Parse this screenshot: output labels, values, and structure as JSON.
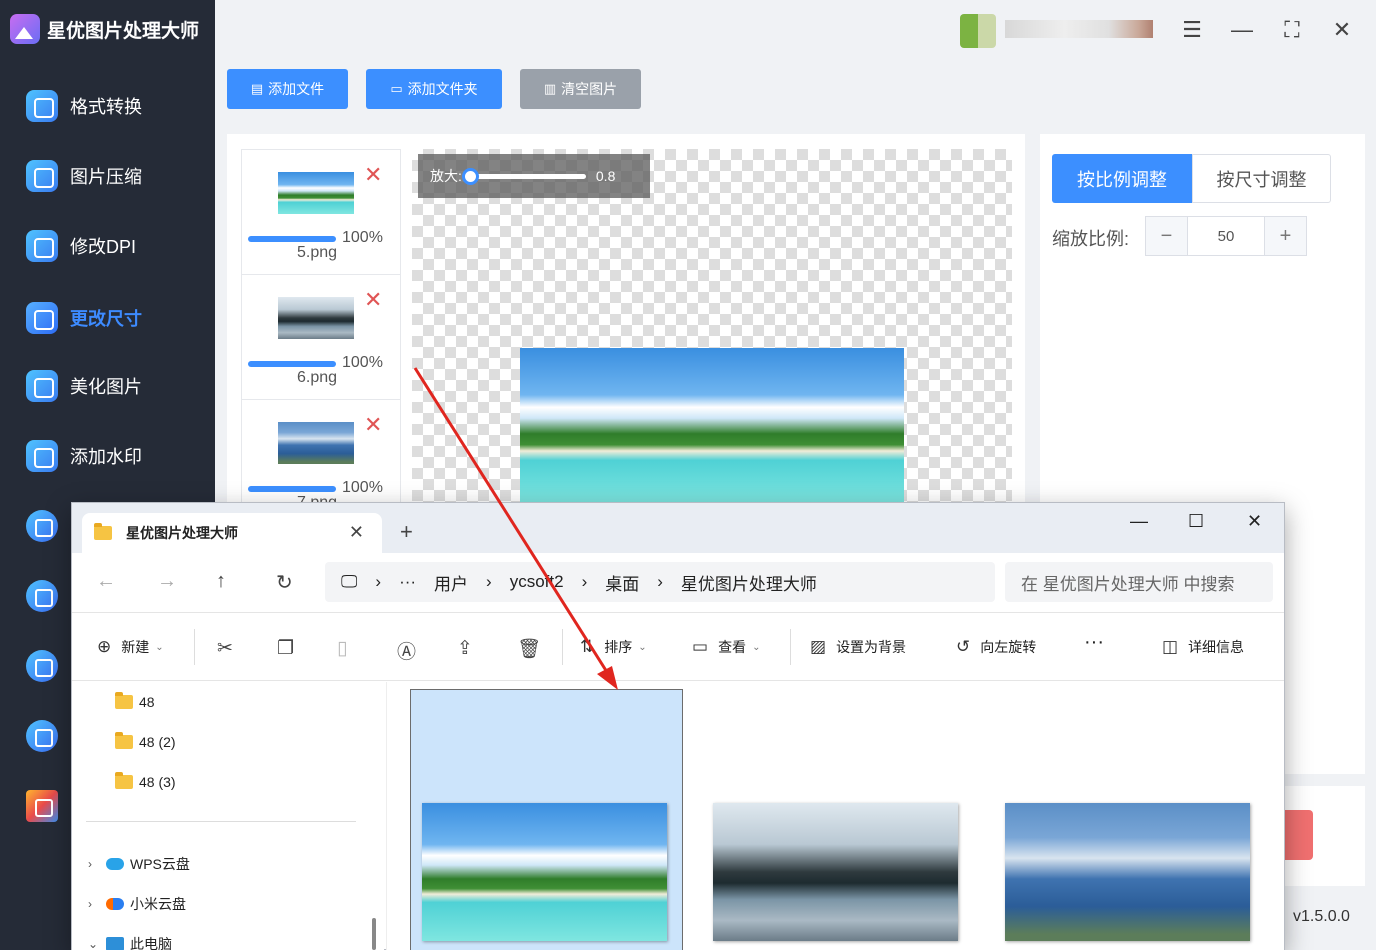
{
  "app": {
    "title": "星优图片处理大师",
    "version": "v1.5.0.0"
  },
  "sidebar": {
    "items": [
      {
        "label": "格式转换"
      },
      {
        "label": "图片压缩"
      },
      {
        "label": "修改DPI"
      },
      {
        "label": "更改尺寸",
        "active": true
      },
      {
        "label": "美化图片"
      },
      {
        "label": "添加水印"
      }
    ]
  },
  "toolbar": {
    "add_file": "添加文件",
    "add_folder": "添加文件夹",
    "clear": "清空图片"
  },
  "files": [
    {
      "name": "5.png",
      "progress": "100%"
    },
    {
      "name": "6.png",
      "progress": "100%"
    },
    {
      "name": "7.png",
      "progress": "100%"
    }
  ],
  "preview": {
    "zoom_label": "放大:",
    "zoom_value": "0.8",
    "zoom_fraction": 0.0
  },
  "settings": {
    "mode_ratio": "按比例调整",
    "mode_size": "按尺寸调整",
    "scale_label": "缩放比例:",
    "scale_value": "50"
  },
  "explorer": {
    "tab_title": "星优图片处理大师",
    "path": [
      "用户",
      "ycsoft2",
      "桌面",
      "星优图片处理大师"
    ],
    "search_placeholder": "在 星优图片处理大师 中搜索",
    "commands": {
      "new": "新建",
      "sort": "排序",
      "view": "查看",
      "set_bg": "设置为背景",
      "rotate_left": "向左旋转",
      "details": "详细信息"
    },
    "tree": [
      {
        "label": "48"
      },
      {
        "label": "48 (2)"
      },
      {
        "label": "48 (3)"
      },
      {
        "label": "WPS云盘"
      },
      {
        "label": "小米云盘"
      },
      {
        "label": "此电脑"
      }
    ]
  },
  "colors": {
    "accent": "#3c8fff",
    "sidebar_bg": "#252b37",
    "danger": "#e05555"
  }
}
